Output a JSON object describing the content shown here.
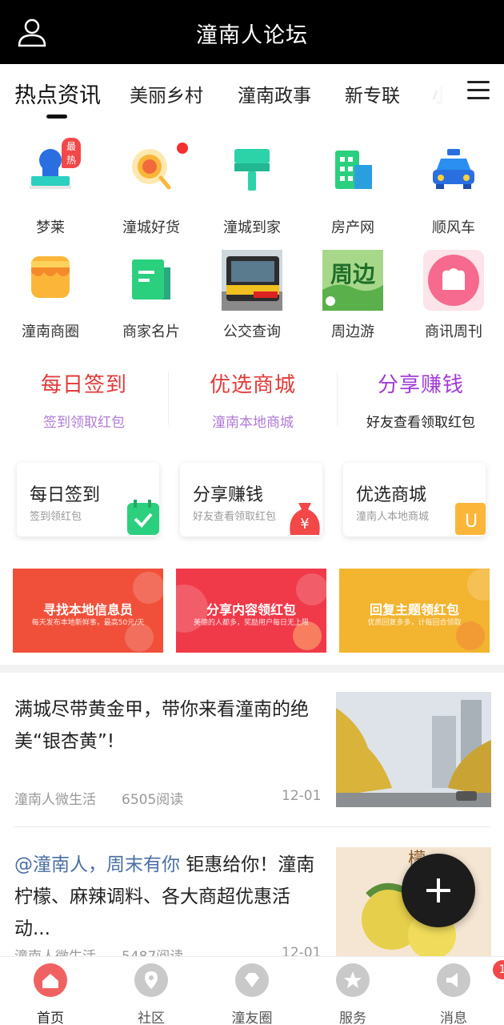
{
  "header": {
    "title": "潼南人论坛"
  },
  "tabs": [
    "热点资讯",
    "美丽乡村",
    "潼南政事",
    "新专联",
    "小"
  ],
  "grid": [
    {
      "label": "梦莱",
      "icon": "stamp-icon",
      "badge": "最热"
    },
    {
      "label": "潼城好货",
      "icon": "search-goods-icon"
    },
    {
      "label": "潼城到家",
      "icon": "paint-roller-icon"
    },
    {
      "label": "房产网",
      "icon": "building-icon"
    },
    {
      "label": "顺风车",
      "icon": "taxi-icon"
    },
    {
      "label": "潼南商圈",
      "icon": "shop-icon"
    },
    {
      "label": "商家名片",
      "icon": "card-icon"
    },
    {
      "label": "公交查询",
      "icon": "bus-photo"
    },
    {
      "label": "周边游",
      "icon": "travel-photo",
      "photo_text": "周边"
    },
    {
      "label": "商讯周刊",
      "icon": "magazine-icon"
    }
  ],
  "promos": [
    {
      "title": "每日签到",
      "sub": "签到领取红包",
      "title_color": "#e23a3a",
      "sub_color": "#b07ad6"
    },
    {
      "title": "优选商城",
      "sub": "潼南本地商城",
      "title_color": "#e23a3a",
      "sub_color": "#b07ad6"
    },
    {
      "title": "分享赚钱",
      "sub": "好友查看领取红包",
      "title_color": "#a23bd6",
      "sub_color": "#222222"
    }
  ],
  "cards": [
    {
      "title": "每日签到",
      "sub": "签到领红包"
    },
    {
      "title": "分享赚钱",
      "sub": "好友查看领取红包",
      "icon_text": "¥"
    },
    {
      "title": "优选商城",
      "sub": "潼南人本地商城",
      "icon_text": "U"
    }
  ],
  "banners": [
    {
      "title": "寻找本地信息员",
      "sub": "每天发布本地新鲜事，最高50元/天",
      "color": "#f0503a"
    },
    {
      "title": "分享内容领红包",
      "sub": "美德的人都多，奖励用户每日无上限",
      "color": "#f03a4a"
    },
    {
      "title": "回复主题领红包",
      "sub": "优质回复多多，计每回合领取",
      "color": "#f3b430"
    }
  ],
  "news": [
    {
      "title": "满城尽带黄金甲，带你来看潼南的绝美“银杏黄”!",
      "source": "潼南人微生活",
      "reads": "6505阅读",
      "date": "12-01"
    },
    {
      "title_highlight": "@潼南人，周末有你",
      "title": " 钜惠给你！潼南柠檬、麻辣调料、各大商超优惠活动...",
      "source": "潼南人微生活",
      "reads": "5487阅读",
      "date": "12-01",
      "img_text": "檬"
    }
  ],
  "bottom_nav": [
    {
      "label": "首页",
      "icon": "home-icon"
    },
    {
      "label": "社区",
      "icon": "location-icon"
    },
    {
      "label": "潼友圈",
      "icon": "diamond-icon"
    },
    {
      "label": "服务",
      "icon": "star-icon"
    },
    {
      "label": "消息",
      "icon": "speaker-icon",
      "badge": "1"
    }
  ]
}
